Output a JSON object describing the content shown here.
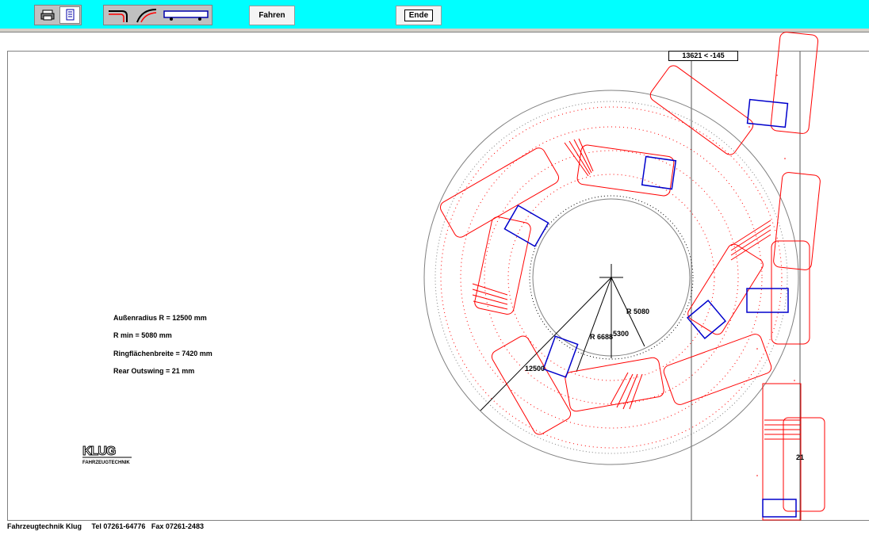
{
  "toolbar": {
    "print_icon": "printer-icon",
    "doc_icon": "document-icon",
    "turn_icon": "turn-path-icon",
    "curve_icon": "curve-path-icon",
    "bus_icon": "bus-icon",
    "fahren_label": "Fahren",
    "ende_label": "Ende"
  },
  "coordinate_readout": "13621 < -145",
  "info": {
    "outer_radius": "Außenradius R  =  12500 mm",
    "r_min": "R min = 5080 mm",
    "ring_width": "Ringflächenbreite = 7420 mm",
    "rear_outswing": "Rear Outswing = 21 mm"
  },
  "dimensions": {
    "outer": "12500",
    "r5080": "R 5080",
    "r6688": "R 6688",
    "r5300": "5300",
    "outswing": "21"
  },
  "logo": {
    "brand": "KLUG",
    "tagline": "FAHRZEUGTECHNIK"
  },
  "footer": "Fahrzeugtechnik Klug     Tel 07261-64776   Fax 07261-2483",
  "colors": {
    "toolbar_bg": "#00ffff",
    "vehicle": "#ff0000",
    "axle": "#0000cc",
    "circle": "#808080"
  }
}
